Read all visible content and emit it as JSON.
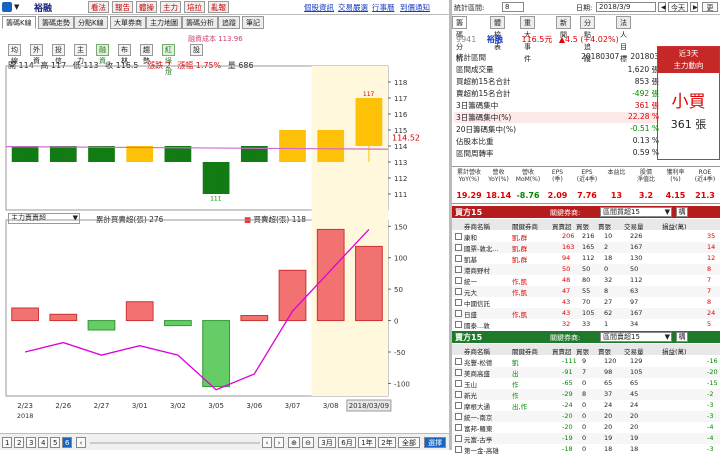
{
  "top": {
    "stock_name": "裕融",
    "nav_tabs": [
      "看法",
      "報告",
      "體操",
      "主力",
      "培拉",
      "亂報"
    ],
    "right_links": [
      "個股資訊",
      "交易嚴選",
      "行事曆",
      "到價通知"
    ]
  },
  "tabs2": [
    "籌碼K線",
    "籌碼走勢",
    "分點K線",
    "大單券商",
    "主力地圖",
    "籌碼分析",
    "追蹤",
    "筆記"
  ],
  "chart_controls": {
    "buttons": [
      "均線",
      "外資",
      "投信",
      "主力",
      "融資",
      "布林",
      "趨勢",
      "紅綠燈",
      "設"
    ],
    "cost_label": "融資成本 113.96"
  },
  "ohlc": {
    "open": "開 114",
    "high": "高 117",
    "low": "低 113",
    "close": "收 116.5",
    "change": "漲跌 2",
    "pct": "漲幅 1.75%",
    "vol": "量 686"
  },
  "chart_data": [
    {
      "type": "bar",
      "categories": [
        "2/23",
        "2/26",
        "2/27",
        "3/01",
        "3/02",
        "3/05",
        "3/06",
        "3/07",
        "3/08",
        "2018/03/09"
      ],
      "series": [
        {
          "name": "candles",
          "open": [
            113,
            114,
            114,
            114,
            114,
            113,
            114,
            113,
            115,
            114
          ],
          "close": [
            114,
            113,
            113,
            113,
            113,
            111,
            113,
            115,
            113,
            117
          ],
          "high": [
            114,
            114,
            114,
            114,
            114,
            113,
            114,
            115,
            115,
            117
          ],
          "low": [
            113,
            113,
            113,
            113,
            113,
            111,
            113,
            113,
            113,
            113
          ]
        }
      ],
      "ylim": [
        110,
        119
      ],
      "yticks": [
        111,
        112,
        113,
        114,
        115,
        116,
        117,
        118
      ],
      "last_price": "114.52",
      "markers": [
        "117",
        "111"
      ]
    },
    {
      "type": "bar",
      "legend_selector": "主力賣賣超",
      "legend_line": "累計買賣超(張) 276",
      "legend_bar": "買賣超(張) 118",
      "categories": [
        "2/23",
        "2/26",
        "2/27",
        "3/01",
        "3/02",
        "3/05",
        "3/06",
        "3/07",
        "3/08",
        "2018/03/09"
      ],
      "values": [
        20,
        10,
        -15,
        30,
        -8,
        -105,
        8,
        80,
        145,
        118
      ],
      "cumulative": [
        -50,
        -35,
        -55,
        -40,
        -55,
        -110,
        -85,
        15,
        80,
        145
      ],
      "ylim": [
        -120,
        160
      ],
      "yticks": [
        150,
        100,
        50,
        0,
        -50,
        -100
      ]
    }
  ],
  "bottom": {
    "pages": [
      "1",
      "2",
      "3",
      "4",
      "5",
      "6"
    ],
    "ranges": [
      "3月",
      "6月",
      "1年",
      "2年",
      "全部",
      "選擇"
    ],
    "xaxis_year": "2018"
  },
  "right_top": {
    "label1": "統計區間:",
    "sel1": "8",
    "label2": "日期:",
    "date": "2018/3/9",
    "today": "今天",
    "more": "更"
  },
  "right_tabs": [
    "籌碼分析",
    "體檢表",
    "重大事件",
    "新聞",
    "分點追蹤",
    "法人目標"
  ],
  "stock_line": {
    "code": "9941",
    "name": "裕融",
    "price": "116.5元",
    "change": "▲4.5 (+4.02%)"
  },
  "stats": [
    {
      "label": "統計區間",
      "value": "20180307 ~ 201803"
    },
    {
      "label": "區間成交量",
      "value": "1,620 張"
    },
    {
      "label": "買超前15名合計",
      "value": "853 張"
    },
    {
      "label": "賣超前15名合計",
      "value": "-492 張"
    },
    {
      "label": "3日籌碼集中",
      "value": "361 張"
    },
    {
      "label": "3日籌碼集中(%)",
      "value": "22.28 %"
    },
    {
      "label": "20日籌碼集中(%)",
      "value": "-0.51 %"
    },
    {
      "label": "佔股本比重",
      "value": "0.13 %"
    },
    {
      "label": "區間周轉率",
      "value": "0.59 %"
    }
  ],
  "trend": {
    "head1": "近3天",
    "head2": "主力動向",
    "verdict": "小買",
    "amount": "361 張"
  },
  "kpi": [
    {
      "h": "累計營收\nYoY(%)",
      "v": "19.29"
    },
    {
      "h": "營收\nYoY(%)",
      "v": "18.14"
    },
    {
      "h": "營收\nMoM(%)",
      "v": "-8.76"
    },
    {
      "h": "EPS\n(季)",
      "v": "2.09"
    },
    {
      "h": "EPS\n(近4季)",
      "v": "7.76"
    },
    {
      "h": "本益比",
      "v": "13"
    },
    {
      "h": "股價\n淨值比",
      "v": "3.2"
    },
    {
      "h": "獲利率\n(%)",
      "v": "4.15"
    },
    {
      "h": "ROE\n(近4季)",
      "v": "21.3"
    }
  ],
  "buy": {
    "title": "買方15",
    "filter_label": "關鍵券商:",
    "filter_value": "區間買超15",
    "ctrl": "構",
    "headers": [
      "券商名稱",
      "關鍵券商",
      "買賣超",
      "買張",
      "賣張",
      "交易量",
      "損益(萬)"
    ],
    "rows": [
      [
        "康和",
        "凱,群",
        "206",
        "216",
        "10",
        "226",
        "35"
      ],
      [
        "國票-敦北...",
        "凱,群",
        "163",
        "165",
        "2",
        "167",
        "14"
      ],
      [
        "凱基",
        "凱,群",
        "94",
        "112",
        "18",
        "130",
        "12"
      ],
      [
        "港商野村",
        "",
        "50",
        "50",
        "0",
        "50",
        "8"
      ],
      [
        "統一",
        "作,凱",
        "48",
        "80",
        "32",
        "112",
        "7"
      ],
      [
        "元大",
        "作,凱",
        "47",
        "55",
        "8",
        "63",
        "7"
      ],
      [
        "中國信託",
        "",
        "43",
        "70",
        "27",
        "97",
        "8"
      ],
      [
        "日盛",
        "作,凱",
        "43",
        "105",
        "62",
        "167",
        "24"
      ],
      [
        "國泰...敦",
        "",
        "32",
        "33",
        "1",
        "34",
        "5"
      ]
    ]
  },
  "sell": {
    "title": "賣方15",
    "filter_label": "關鍵券商:",
    "filter_value": "區間賣超15",
    "ctrl": "構",
    "headers": [
      "券商名稱",
      "關鍵券商",
      "買賣超",
      "買張",
      "賣張",
      "交易量",
      "損益(萬)"
    ],
    "rows": [
      [
        "兆豐-松德",
        "凱",
        "-111",
        "9",
        "120",
        "129",
        "-16"
      ],
      [
        "美商高盛",
        "出",
        "-91",
        "7",
        "98",
        "105",
        "-20"
      ],
      [
        "玉山",
        "作",
        "-65",
        "0",
        "65",
        "65",
        "-15"
      ],
      [
        "新光",
        "作",
        "-29",
        "8",
        "37",
        "45",
        "-2"
      ],
      [
        "摩根大通",
        "出,作",
        "-24",
        "0",
        "24",
        "24",
        "-3"
      ],
      [
        "統一-南京",
        "",
        "-20",
        "0",
        "20",
        "20",
        "-3"
      ],
      [
        "富邦-羅東",
        "",
        "-20",
        "0",
        "20",
        "20",
        "-4"
      ],
      [
        "元富-古亭",
        "",
        "-19",
        "0",
        "19",
        "19",
        "-4"
      ],
      [
        "第一金-高雄",
        "",
        "-18",
        "0",
        "18",
        "18",
        "-3"
      ]
    ]
  }
}
